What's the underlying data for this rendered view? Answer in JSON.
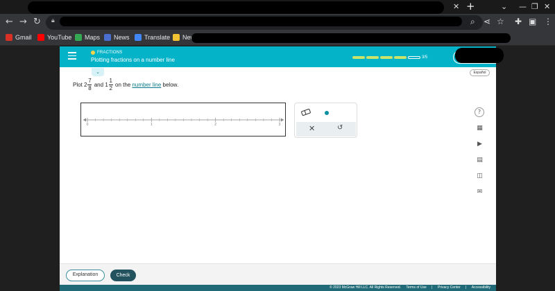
{
  "browser": {
    "bookmarks": [
      {
        "label": "Gmail",
        "color": "#d93025"
      },
      {
        "label": "YouTube",
        "color": "#ff0000"
      },
      {
        "label": "Maps",
        "color": "#34a853"
      },
      {
        "label": "News",
        "color": "#4a6fd1"
      },
      {
        "label": "Translate",
        "color": "#4285f4"
      },
      {
        "label": "New",
        "color": "#f1c232"
      }
    ]
  },
  "header": {
    "topic": "FRACTIONS",
    "title": "Plotting fractions on a number line",
    "progress_label": "3/5",
    "progress_segments_total": 5,
    "progress_segments_done": 4,
    "accent": "#05b3c9"
  },
  "language_label": "Español",
  "prompt": {
    "prefix": "Plot",
    "first_whole": "2",
    "first_num": "7",
    "first_den": "8",
    "and": "and",
    "second_whole": "1",
    "second_num": "1",
    "second_den": "2",
    "on_the": "on the",
    "link": "number line",
    "suffix": "below."
  },
  "number_line": {
    "labels": [
      "0",
      "1",
      "2",
      "3"
    ],
    "min": 0,
    "max": 3,
    "minor_ticks_per_unit": 8
  },
  "toolbox": {
    "eraser_icon": "eraser-icon",
    "point_icon": "point-tool-icon",
    "clear_icon": "close-icon",
    "undo_icon": "undo-icon"
  },
  "side_tools": [
    "help-icon",
    "calculator-icon",
    "video-icon",
    "calculator-icon",
    "save-icon",
    "mail-icon"
  ],
  "footer": {
    "explanation_label": "Explanation",
    "check_label": "Check",
    "copyright": "© 2023 McGraw Hill LLC. All Rights Reserved.",
    "terms": "Terms of Use",
    "privacy": "Privacy Center",
    "accessibility": "Accessibility"
  }
}
